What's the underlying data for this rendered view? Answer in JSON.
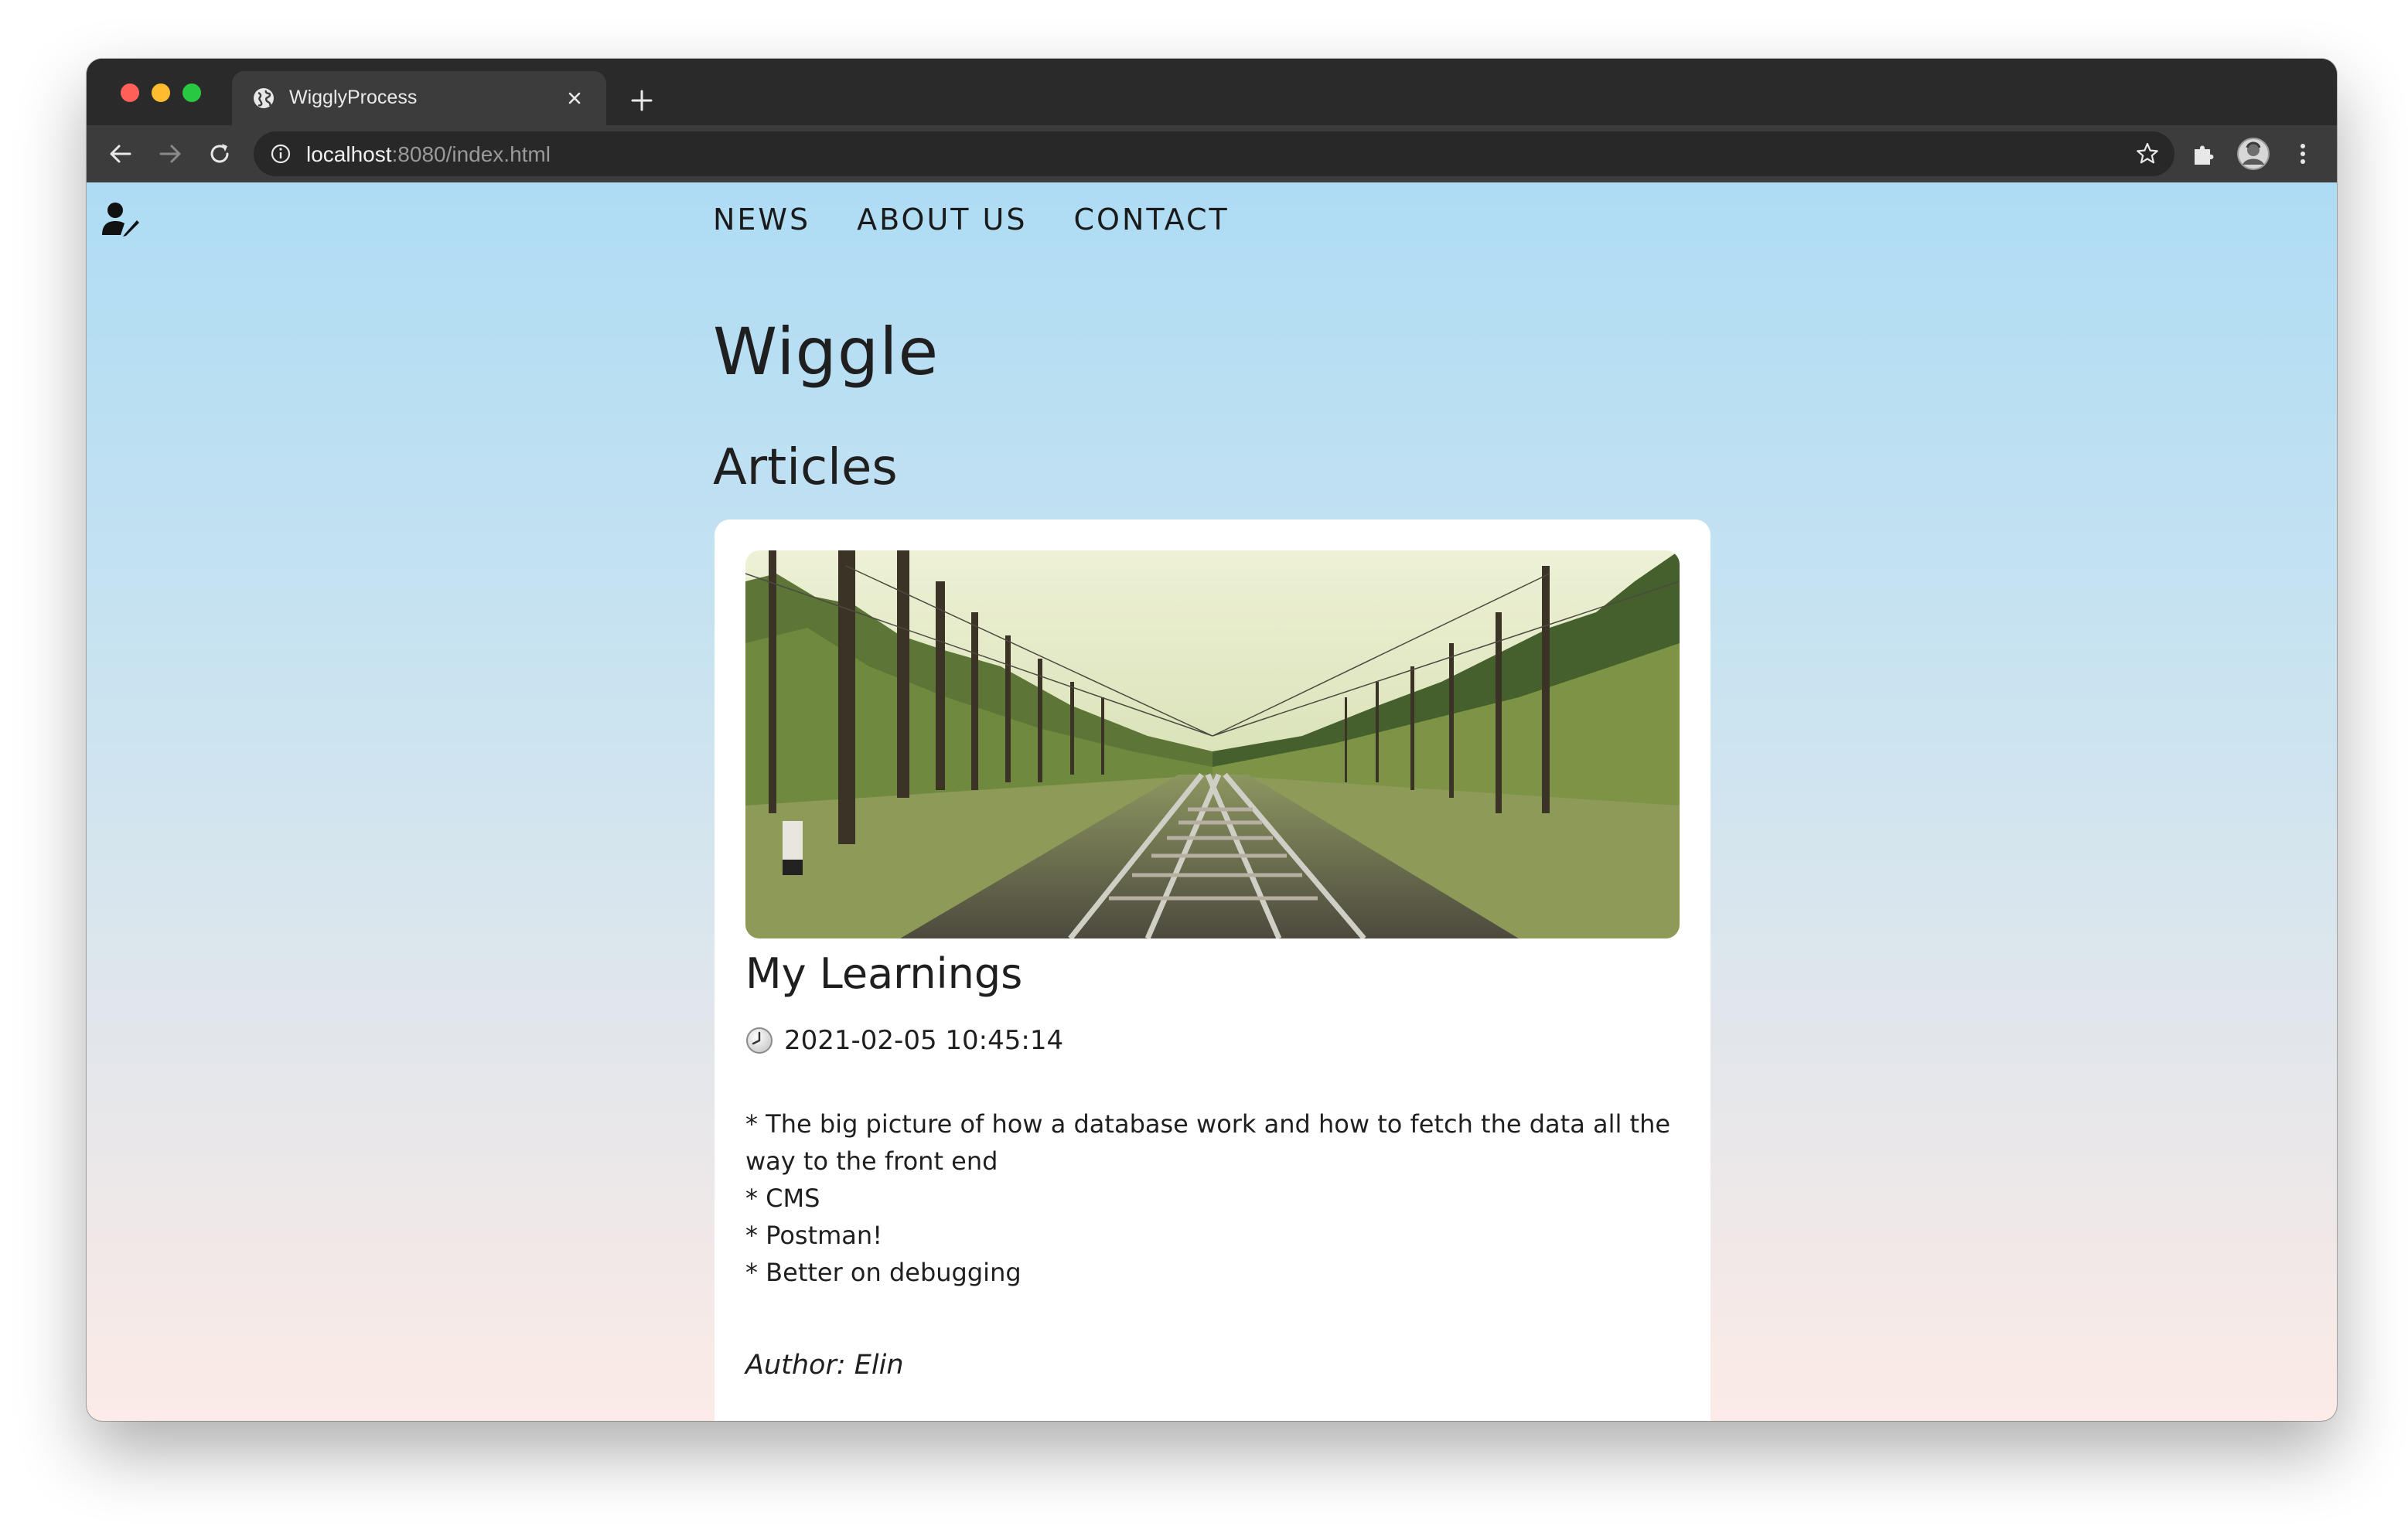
{
  "browser": {
    "tab_title": "WigglyProcess",
    "url_host": "localhost",
    "url_path": ":8080/index.html",
    "icons": {
      "back": "arrow-left-icon",
      "forward": "arrow-right-icon",
      "reload": "reload-icon",
      "site_info": "info-icon",
      "bookmark": "star-icon",
      "extensions": "puzzle-icon",
      "profile": "avatar",
      "menu": "kebab-menu-icon"
    }
  },
  "nav": {
    "items": [
      "NEWS",
      "ABOUT US",
      "CONTACT"
    ]
  },
  "site": {
    "title": "Wiggle",
    "section_title": "Articles"
  },
  "article": {
    "title": "My Learnings",
    "date": "2021-02-05 10:45:14",
    "body_lines": [
      "* The big picture of how a database work and how to fetch the data all the",
      "way to the front end",
      "* CMS",
      "* Postman!",
      "* Better on debugging"
    ],
    "author": "Author: Elin"
  },
  "colors": {
    "page_gradient_top": "#aedcf4",
    "page_gradient_bottom": "#fcebe6",
    "card": "#ffffff",
    "text": "#1f1f1f"
  }
}
